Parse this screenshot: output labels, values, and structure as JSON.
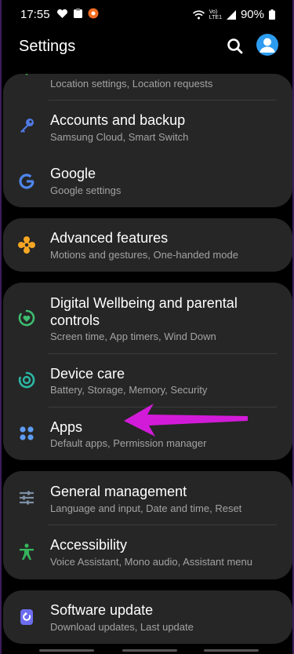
{
  "status_bar": {
    "time": "17:55",
    "network_small_top": "Vo)",
    "network_small_bottom": "LTE1",
    "battery": "90%"
  },
  "header": {
    "title": "Settings"
  },
  "items": {
    "location": {
      "subtitle": "Location settings, Location requests"
    },
    "accounts": {
      "title": "Accounts and backup",
      "subtitle": "Samsung Cloud, Smart Switch"
    },
    "google": {
      "title": "Google",
      "subtitle": "Google settings"
    },
    "advanced": {
      "title": "Advanced features",
      "subtitle": "Motions and gestures, One-handed mode"
    },
    "wellbeing": {
      "title_line1": "Digital Wellbeing and parental",
      "title_line2": "controls",
      "subtitle": "Screen time, App timers, Wind Down"
    },
    "device_care": {
      "title": "Device care",
      "subtitle": "Battery, Storage, Memory, Security"
    },
    "apps": {
      "title": "Apps",
      "subtitle": "Default apps, Permission manager"
    },
    "general": {
      "title": "General management",
      "subtitle": "Language and input, Date and time, Reset"
    },
    "accessibility": {
      "title": "Accessibility",
      "subtitle": "Voice Assistant, Mono audio, Assistant menu"
    },
    "software_update": {
      "title": "Software update",
      "subtitle": "Download updates, Last update"
    }
  },
  "colors": {
    "arrow": "#d21bd8",
    "accent_blue": "#2d9cf0"
  }
}
